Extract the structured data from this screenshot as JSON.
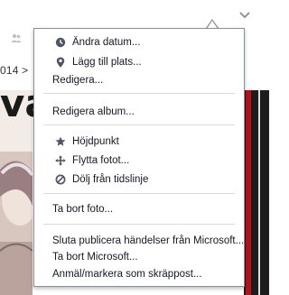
{
  "background": {
    "date_fragment": "014 >",
    "hero_word_fragment": "va"
  },
  "menu": {
    "change_date": "Ändra datum...",
    "add_place": "Lägg till plats...",
    "edit": "Redigera...",
    "edit_album": "Redigera album...",
    "highlight": "Höjdpunkt",
    "move_photo": "Flytta fotot...",
    "hide_from_timeline": "Dölj från tidslinje",
    "delete_photo": "Ta bort foto...",
    "stop_publishing": "Sluta publicera händelser från Microsoft...",
    "remove_microsoft": "Ta bort Microsoft...",
    "report_spam": "Anmäl/markera som skräppost..."
  },
  "colors": {
    "menu_border": "#8b8f96",
    "text": "#141823",
    "icon": "#4e5665",
    "separator": "#d8dadd"
  }
}
